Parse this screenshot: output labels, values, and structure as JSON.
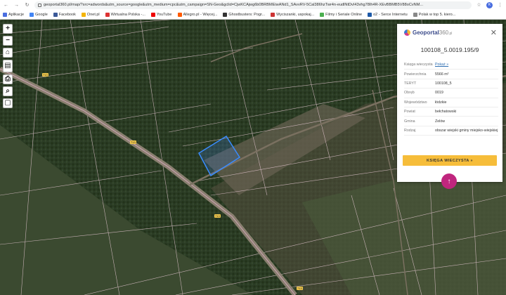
{
  "browser": {
    "url": "geoportal360.pl/map/?src=adwords&utm_source=google&utm_medium=cpc&utm_campaign=SN-Geo&gclid=CjwKCAjwg6b0BRBMEiwANd1_SAvvRV-5Cal386hzTwr4n-eudlNtDvI43vhg78Ih4R-XEvBBMB5V88oCvNM...",
    "avatar": "K"
  },
  "bookmarks": [
    {
      "label": "Aplikacje",
      "color": "#4a6ee0"
    },
    {
      "label": "Google",
      "color": "#4285f4"
    },
    {
      "label": "Facebook",
      "color": "#3b5998"
    },
    {
      "label": "Onet.pl",
      "color": "#f4b400"
    },
    {
      "label": "Wirtualna Polska -...",
      "color": "#d33"
    },
    {
      "label": "YouTube",
      "color": "#e00"
    },
    {
      "label": "Allegro.pl - Więcej...",
      "color": "#ff5a00"
    },
    {
      "label": "Ghostbusters: Pogr...",
      "color": "#333"
    },
    {
      "label": "Wyciszanki, uspokaj...",
      "color": "#c33"
    },
    {
      "label": "Filmy i Seriale Online",
      "color": "#4caf50"
    },
    {
      "label": "o2 - Serce Internetu",
      "color": "#1e5aa8"
    },
    {
      "label": "Polak w top 5. kiero...",
      "color": "#888"
    }
  ],
  "map": {
    "road_labels": [
      "713",
      "713",
      "713",
      "713"
    ]
  },
  "panel": {
    "logo_main": "Geoportal",
    "logo_suffix": "360",
    "logo_tld": ".pl",
    "parcel_id": "100108_5.0019.195/9",
    "rows": [
      {
        "key": "Księga wieczysta",
        "value": "Pokaż »",
        "link": true
      },
      {
        "key": "Powierzchnia",
        "value": "5566 m²",
        "link": false
      },
      {
        "key": "TERYT",
        "value": "100108_5",
        "link": false
      },
      {
        "key": "Obręb",
        "value": "0019",
        "link": false
      },
      {
        "key": "Województwo",
        "value": "łódzkie",
        "link": false
      },
      {
        "key": "Powiat",
        "value": "bełchatowski",
        "link": false
      },
      {
        "key": "Gmina",
        "value": "Zelów",
        "link": false
      },
      {
        "key": "Rodzaj",
        "value": "obszar wiejski gminy miejsko-wiejskiej",
        "link": false
      }
    ],
    "button_label": "KSIĘGA WIECZYSTA »"
  }
}
